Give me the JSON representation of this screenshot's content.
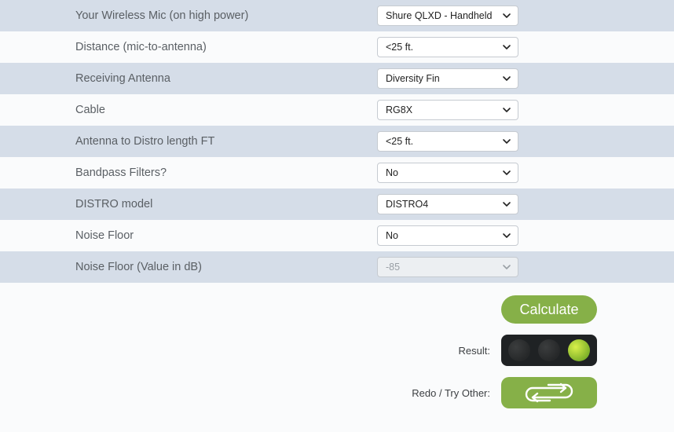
{
  "rows": [
    {
      "label": "Your Wireless Mic (on high power)",
      "value": "Shure QLXD - Handheld",
      "shade": true,
      "disabled": false,
      "name": "wireless-mic"
    },
    {
      "label": "Distance (mic-to-antenna)",
      "value": "<25 ft.",
      "shade": false,
      "disabled": false,
      "name": "distance"
    },
    {
      "label": "Receiving Antenna",
      "value": "Diversity Fin",
      "shade": true,
      "disabled": false,
      "name": "receiving-antenna"
    },
    {
      "label": "Cable",
      "value": "RG8X",
      "shade": false,
      "disabled": false,
      "name": "cable"
    },
    {
      "label": "Antenna to Distro length FT",
      "value": "<25 ft.",
      "shade": true,
      "disabled": false,
      "name": "antenna-distro-length"
    },
    {
      "label": "Bandpass Filters?",
      "value": "No",
      "shade": false,
      "disabled": false,
      "name": "bandpass-filters"
    },
    {
      "label": "DISTRO model",
      "value": "DISTRO4",
      "shade": true,
      "disabled": false,
      "name": "distro-model"
    },
    {
      "label": "Noise Floor",
      "value": "No",
      "shade": false,
      "disabled": false,
      "name": "noise-floor"
    },
    {
      "label": "Noise Floor (Value in dB)",
      "value": "-85",
      "shade": true,
      "disabled": true,
      "name": "noise-floor-db"
    }
  ],
  "footer": {
    "calculate": "Calculate",
    "result_label": "Result:",
    "redo_label": "Redo / Try Other:"
  },
  "traffic": {
    "red": false,
    "yellow": false,
    "green": true
  }
}
